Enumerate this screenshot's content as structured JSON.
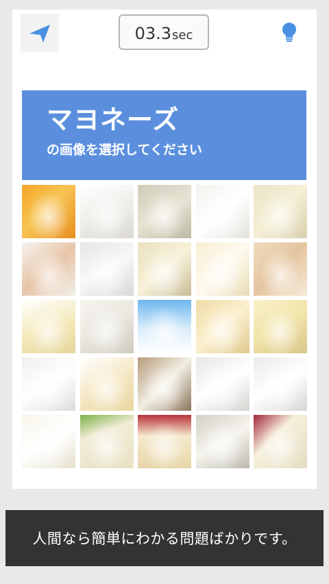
{
  "header": {
    "back_icon": "back-arrow-icon",
    "timer_value": "03.3",
    "timer_unit": "sec",
    "hint_icon": "lightbulb-icon",
    "accent_color": "#4a90e2"
  },
  "banner": {
    "target": "マヨネーズ",
    "instruction": "の画像を選択してください",
    "color": "#5b8fde"
  },
  "tiles": [
    {
      "bg": "linear-gradient(135deg,#f4a62a 0%,#f7c453 45%,#e98d1e 100%)"
    },
    {
      "bg": "linear-gradient(160deg,#ffffff 0%,#ecebe6 60%,#d9d7cf 100%)"
    },
    {
      "bg": "linear-gradient(150deg,#cfcbb9 0%,#e8e4d3 50%,#bdb8a4 100%)"
    },
    {
      "bg": "linear-gradient(140deg,#f4f2ee 0%,#ffffff 50%,#e3e1da 100%)"
    },
    {
      "bg": "linear-gradient(135deg,#ebe4c8 0%,#f5efd6 50%,#d8cfae 100%)"
    },
    {
      "bg": "linear-gradient(140deg,#f5f4f0 0%,#e7c4a6 50%,#f0efea 100%)"
    },
    {
      "bg": "linear-gradient(150deg,#e4e6e6 0%,#f8f8f6 50%,#d7d9d8 100%)"
    },
    {
      "bg": "linear-gradient(140deg,#e9e0bf 0%,#f8f2da 50%,#c8bd95 100%)"
    },
    {
      "bg": "linear-gradient(135deg,#f7eed2 0%,#fffaf0 50%,#e8dcb5 100%)"
    },
    {
      "bg": "linear-gradient(135deg,#f0dcc0 0%,#e4c59f 50%,#f6ead8 100%)"
    },
    {
      "bg": "linear-gradient(160deg,#ffffff 0%,#f3e8b8 55%,#e6d69c 100%)"
    },
    {
      "bg": "linear-gradient(150deg,#f7f5ef 0%,#e9e7df 50%,#cfcbc0 100%)"
    },
    {
      "bg": "linear-gradient(180deg,#6fb6ee 0%,#dbeefb 55%,#ffffff 100%)"
    },
    {
      "bg": "linear-gradient(140deg,#efdca8 0%,#fbf0cf 50%,#e0c98e 100%)"
    },
    {
      "bg": "linear-gradient(150deg,#f9f1c9 0%,#f1e4a9 50%,#d7c68a 100%)"
    },
    {
      "bg": "linear-gradient(150deg,#f0f0ee 0%,#ffffff 50%,#dcdcda 100%)"
    },
    {
      "bg": "linear-gradient(150deg,#ffffff 0%,#f4e6c0 55%,#e8d6a0 100%)"
    },
    {
      "bg": "linear-gradient(135deg,#b59b7c 0%,#f2eee2 50%,#8c765e 100%)"
    },
    {
      "bg": "linear-gradient(150deg,#e7e7e5 0%,#ffffff 50%,#d4d4d1 100%)"
    },
    {
      "bg": "linear-gradient(150deg,#ebebe9 0%,#ffffff 50%,#d6d6d3 100%)"
    },
    {
      "bg": "linear-gradient(150deg,#f7f5ea 0%,#ffffff 50%,#e6e1cc 100%)"
    },
    {
      "bg": "linear-gradient(160deg,#7cb24a 0%,#f1ecd6 35%,#e8e1c3 100%)"
    },
    {
      "bg": "linear-gradient(180deg,#b8343b 0%,#f5e9cc 40%,#e8d6a8 100%)"
    },
    {
      "bg": "linear-gradient(150deg,#d3d0c6 0%,#f6f4ee 50%,#bcb8ad 100%)"
    },
    {
      "bg": "linear-gradient(135deg,#a3263a 0%,#f6f0dc 40%,#e4dcc0 100%)"
    }
  ],
  "footer": {
    "caption": "人間なら簡単にわかる問題ばかりです。"
  }
}
